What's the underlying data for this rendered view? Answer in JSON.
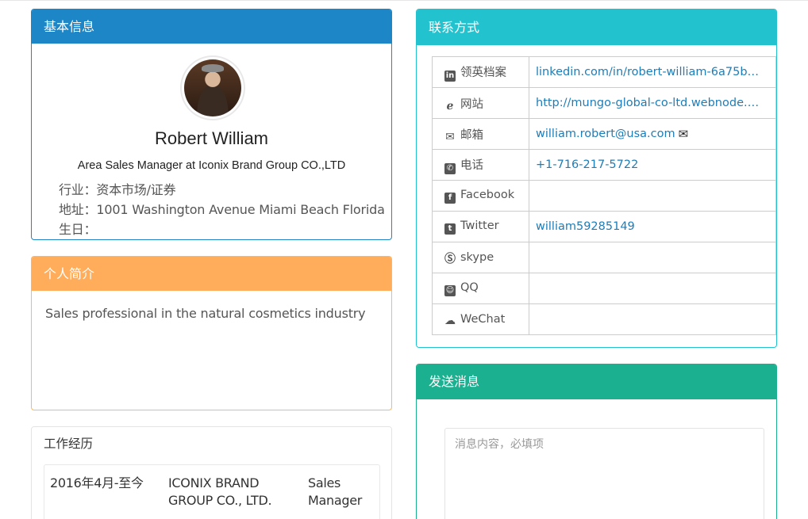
{
  "basic": {
    "heading": "基本信息",
    "name": "Robert William",
    "title": "Area Sales Manager at Iconix Brand Group CO.,LTD",
    "industry": "行业：资本市场/证券",
    "address": "地址：1001 Washington Avenue Miami Beach Florida",
    "birthday": "生日："
  },
  "intro": {
    "heading": "个人简介",
    "text": "Sales professional in the natural cosmetics industry"
  },
  "work": {
    "heading": "工作经历",
    "entries": [
      {
        "period": "2016年4月-至今",
        "company": "ICONIX BRAND GROUP CO., LTD.",
        "company_line1": "ICONIX BRAND",
        "company_line2": "GROUP CO., LTD.",
        "position_line1": "Sales",
        "position_line2": "Manager"
      }
    ]
  },
  "contact": {
    "heading": "联系方式",
    "rows": [
      {
        "icon": "linkedin-icon",
        "label": "领英档案",
        "value": "linkedin.com/in/robert-william-6a75b1..."
      },
      {
        "icon": "ie-globe-icon",
        "label": "网站",
        "value": "http://mungo-global-co-ltd.webnode.c..."
      },
      {
        "icon": "envelope-icon",
        "label": "邮箱",
        "value": "william.robert@usa.com"
      },
      {
        "icon": "phone-icon",
        "label": "电话",
        "value": "+1-716-217-5722"
      },
      {
        "icon": "facebook-icon",
        "label": "Facebook",
        "value": ""
      },
      {
        "icon": "twitter-icon",
        "label": "Twitter",
        "value": "william59285149"
      },
      {
        "icon": "skype-icon",
        "label": "skype",
        "value": ""
      },
      {
        "icon": "qq-icon",
        "label": "QQ",
        "value": ""
      },
      {
        "icon": "wechat-icon",
        "label": "WeChat",
        "value": ""
      }
    ]
  },
  "message": {
    "heading": "发送消息",
    "placeholder": "消息内容，必填项",
    "value": ""
  },
  "colors": {
    "basic": "#1d86c7",
    "intro": "#ffad5b",
    "contact": "#22c3cf",
    "message": "#1bb08f",
    "link": "#1d7db8"
  }
}
